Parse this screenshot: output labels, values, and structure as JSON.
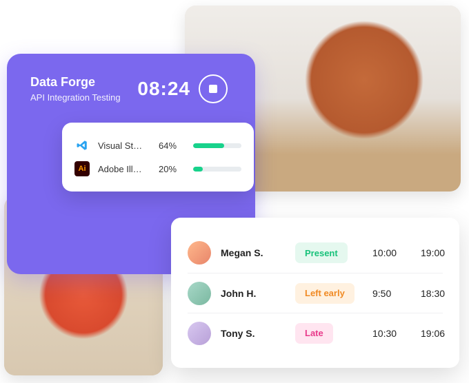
{
  "timer": {
    "title": "Data Forge",
    "subtitle": "API Integration Testing",
    "value": "08:24"
  },
  "apps": [
    {
      "icon": "vscode",
      "name": "Visual St…",
      "pct_label": "64%",
      "pct": 64
    },
    {
      "icon": "illustrator",
      "name": "Adobe Ill…",
      "pct_label": "20%",
      "pct": 20
    }
  ],
  "attendance": [
    {
      "name": "Megan S.",
      "status": "Present",
      "status_kind": "present",
      "start": "10:00",
      "end": "19:00"
    },
    {
      "name": "John H.",
      "status": "Left early",
      "status_kind": "leftearly",
      "start": "9:50",
      "end": "18:30"
    },
    {
      "name": "Tony S.",
      "status": "Late",
      "status_kind": "late",
      "start": "10:30",
      "end": "19:06"
    }
  ],
  "colors": {
    "accent_purple": "#7b68ee",
    "accent_green": "#18d28b",
    "status_present": "#18c27a",
    "status_leftearly": "#f08a24",
    "status_late": "#e83a8a"
  }
}
